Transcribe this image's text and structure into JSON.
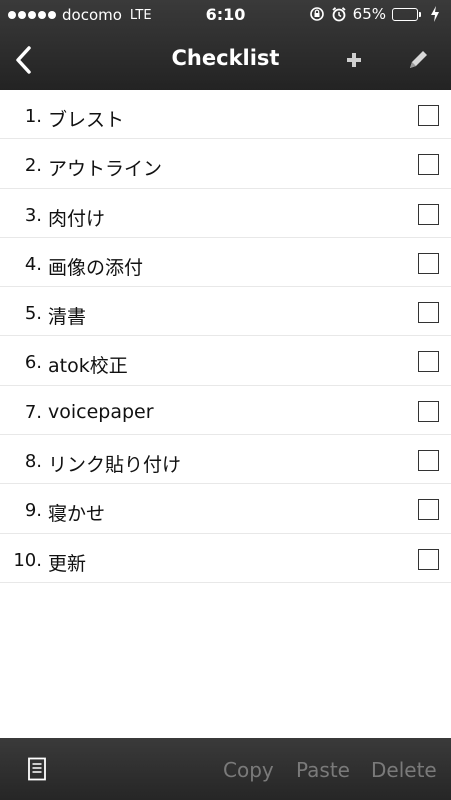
{
  "status_bar": {
    "carrier": "docomo",
    "network": "LTE",
    "time": "6:10",
    "battery_percent": "65%",
    "battery_level": 0.65,
    "icons": [
      "signal-dots-icon",
      "rotation-lock-icon",
      "alarm-icon",
      "battery-icon",
      "charging-icon"
    ]
  },
  "nav": {
    "title": "Checklist",
    "back_icon": "chevron-left-icon",
    "add_icon": "plus-icon",
    "edit_icon": "pencil-icon"
  },
  "items": [
    {
      "number": "1.",
      "label": "ブレスト",
      "checked": false
    },
    {
      "number": "2.",
      "label": "アウトライン",
      "checked": false
    },
    {
      "number": "3.",
      "label": "肉付け",
      "checked": false
    },
    {
      "number": "4.",
      "label": "画像の添付",
      "checked": false
    },
    {
      "number": "5.",
      "label": "清書",
      "checked": false
    },
    {
      "number": "6.",
      "label": "atok校正",
      "checked": false
    },
    {
      "number": "7.",
      "label": "voicepaper",
      "checked": false
    },
    {
      "number": "8.",
      "label": "リンク貼り付け",
      "checked": false
    },
    {
      "number": "9.",
      "label": "寝かせ",
      "checked": false
    },
    {
      "number": "10.",
      "label": "更新",
      "checked": false
    }
  ],
  "toolbar": {
    "doc_icon": "document-icon",
    "copy": "Copy",
    "paste": "Paste",
    "delete": "Delete"
  },
  "colors": {
    "bar_background": "#2b2b2b",
    "battery_fill": "#4cd964",
    "disabled_text": "#7a7a7a"
  }
}
